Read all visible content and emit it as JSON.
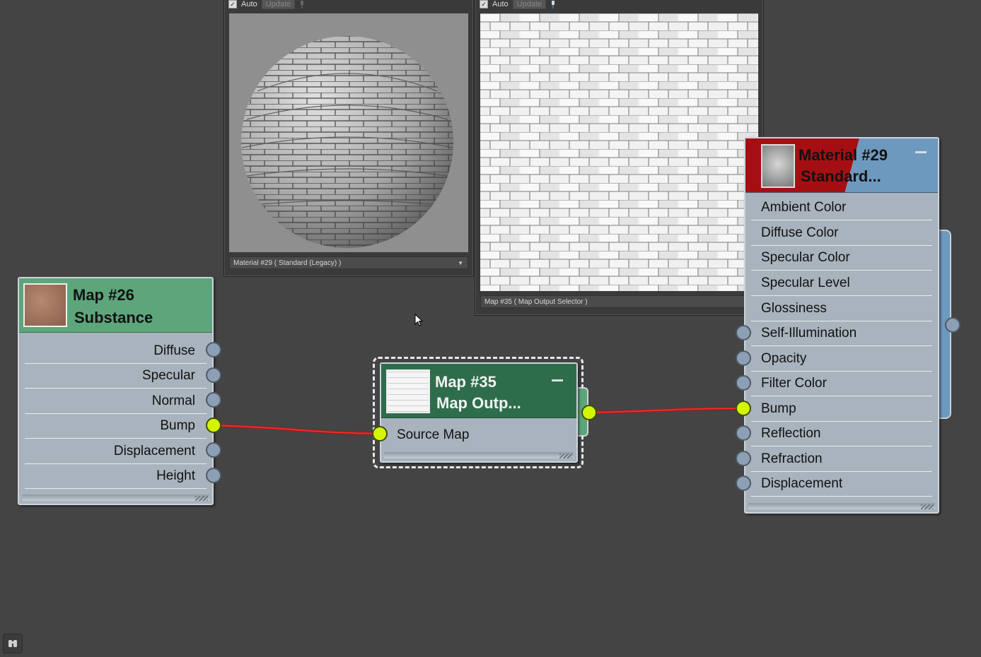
{
  "preview_material": {
    "auto_label": "Auto",
    "update_label": "Update",
    "footer_label": "Material #29  ( Standard (Legacy) )"
  },
  "preview_map": {
    "auto_label": "Auto",
    "update_label": "Update",
    "footer_label": "Map #35  ( Map Output Selector )"
  },
  "node_substance": {
    "title_line1": "Map #26",
    "title_line2": "Substance",
    "outputs": [
      "Diffuse",
      "Specular",
      "Normal",
      "Bump",
      "Displacement",
      "Height"
    ]
  },
  "node_output_selector": {
    "title_line1": "Map #35",
    "title_line2": "Map Outp...",
    "input_label": "Source Map"
  },
  "node_material": {
    "title_line1": "Material #29",
    "title_line2": "Standard...",
    "inputs": [
      "Ambient Color",
      "Diffuse Color",
      "Specular Color",
      "Specular Level",
      "Glossiness",
      "Self-Illumination",
      "Opacity",
      "Filter Color",
      "Bump",
      "Reflection",
      "Refraction",
      "Displacement"
    ]
  },
  "colors": {
    "canvas": "#444444",
    "node_body": "#a9b3bd",
    "map_header": "#5da57b",
    "selector_header": "#2e6d4c",
    "material_header_red": "#a50f13",
    "material_header_blue": "#6e99be",
    "wire": "#e8282b",
    "active_socket": "#d4f500"
  },
  "icons": [
    "checkbox-icon",
    "pin-icon",
    "dropdown-arrow-icon",
    "minimize-icon",
    "resize-grip-icon",
    "binoculars-icon",
    "mouse-cursor-icon"
  ]
}
